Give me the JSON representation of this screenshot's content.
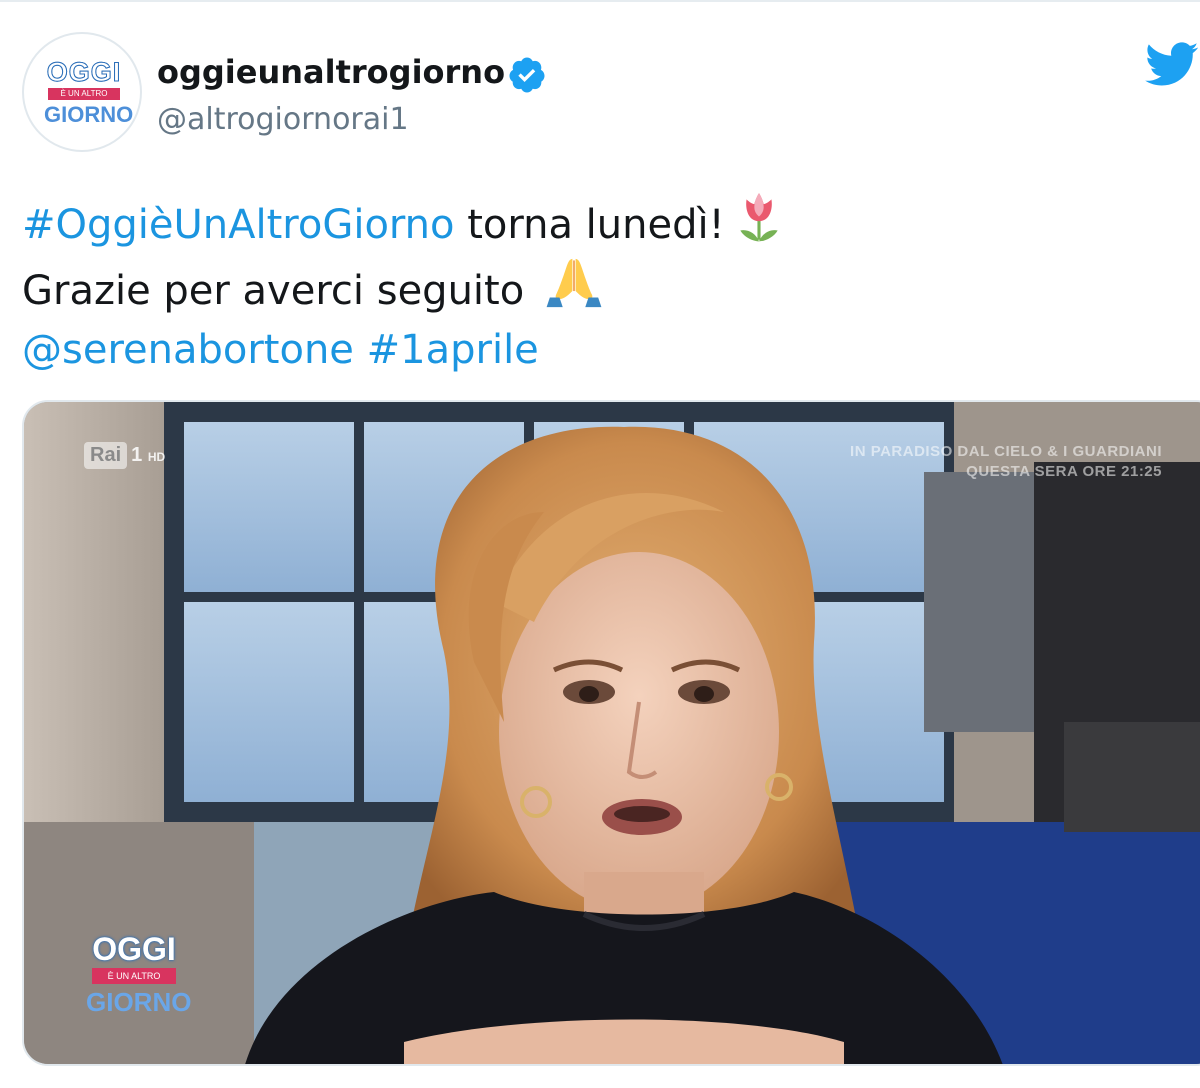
{
  "account": {
    "display_name": "oggieunaltrogiorno",
    "handle": "@altrogiornorai1",
    "verified": true,
    "avatar_logo": {
      "top": "OGGI",
      "band": "È UN ALTRO",
      "bottom": "GIORNO"
    }
  },
  "tweet": {
    "line1": {
      "hashtag": "#OggièUnAltroGiorno",
      "text": " torna lunedì!",
      "emoji": "tulip-icon"
    },
    "line2": {
      "text": "Grazie per averci seguito ",
      "emoji": "folded-hands-icon"
    },
    "line3": {
      "mention": "@serenabortone",
      "space": " ",
      "hashtag": "#1aprile"
    }
  },
  "media": {
    "type": "video",
    "channel_logo": {
      "box": "Rai",
      "num": "1",
      "hd": "HD"
    },
    "promo_line1": "IN PARADISO DAL CIELO & I GUARDIANI",
    "promo_line2": "QUESTA SERA ORE 21:25",
    "watermark": {
      "top": "OGGI",
      "band": "È UN ALTRO",
      "bottom": "GIORNO"
    }
  },
  "colors": {
    "link": "#1b95e0",
    "text": "#14171a",
    "secondary": "#657786",
    "verified": "#1da1f2",
    "twitter_blue": "#1da1f2"
  }
}
